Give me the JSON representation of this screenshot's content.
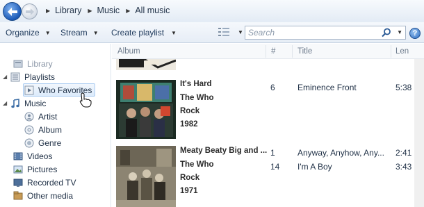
{
  "breadcrumb": [
    "Library",
    "Music",
    "All music"
  ],
  "toolbar": {
    "organize": "Organize",
    "stream": "Stream",
    "create_playlist": "Create playlist",
    "search_placeholder": "Search"
  },
  "nav": {
    "library": "Library",
    "playlists": "Playlists",
    "who_favorites": "Who Favorites",
    "music": "Music",
    "artist": "Artist",
    "album": "Album",
    "genre": "Genre",
    "videos": "Videos",
    "pictures": "Pictures",
    "recorded_tv": "Recorded TV",
    "other_media": "Other media"
  },
  "columns": {
    "album": "Album",
    "number": "#",
    "title": "Title",
    "length": "Len"
  },
  "albums": [
    {
      "name": "It's Hard",
      "artist": "The Who",
      "genre": "Rock",
      "year": "1982",
      "tracks": [
        {
          "number": "6",
          "title": "Eminence Front",
          "length": "5:38"
        }
      ]
    },
    {
      "name": "Meaty Beaty Big and ...",
      "artist": "The Who",
      "genre": "Rock",
      "year": "1971",
      "tracks": [
        {
          "number": "1",
          "title": "Anyway, Anyhow, Any...",
          "length": "2:41"
        },
        {
          "number": "14",
          "title": "I'm A Boy",
          "length": "3:43"
        }
      ]
    }
  ],
  "colors": {
    "accent": "#1d5bb8",
    "nav_hover": "#dcebfb",
    "text": "#1e2f45"
  }
}
